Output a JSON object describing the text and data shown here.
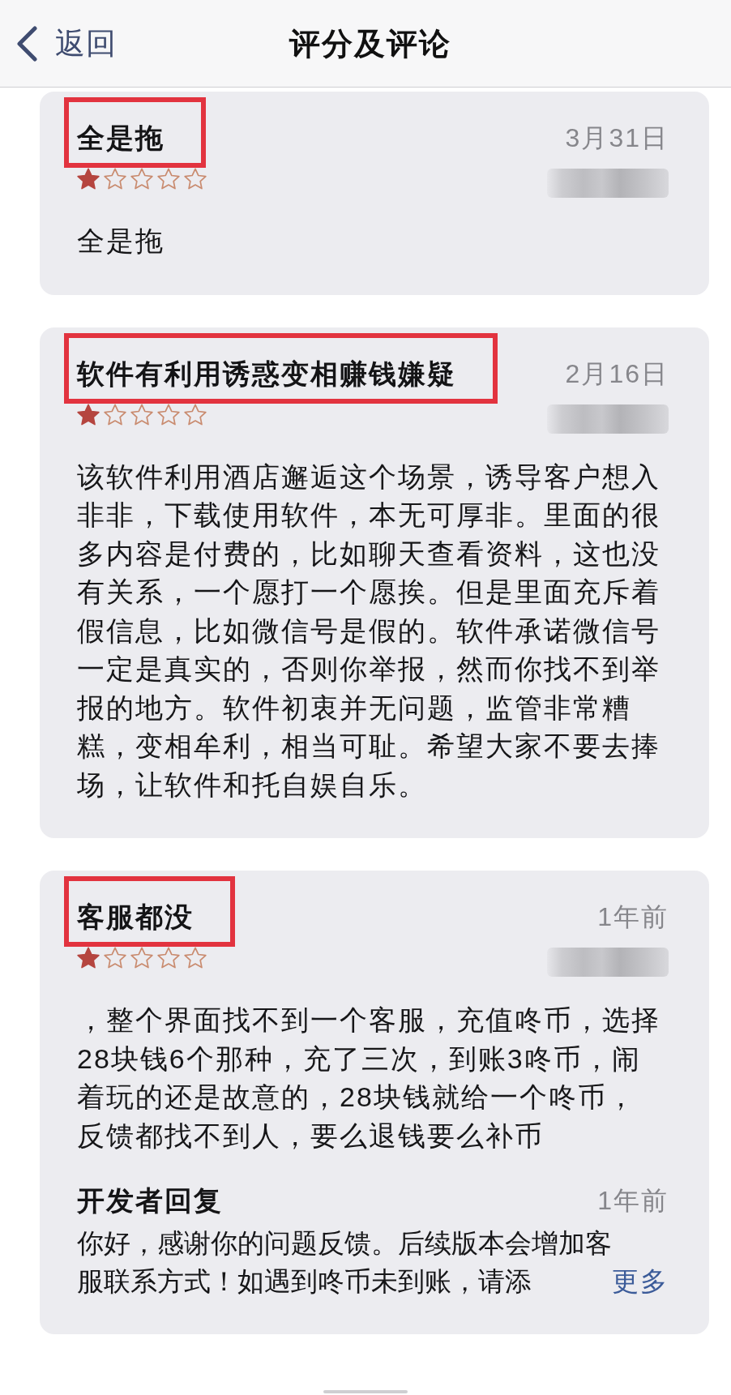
{
  "nav_bar": {
    "back_label": "返回",
    "title": "评分及评论"
  },
  "reviews": [
    {
      "title": "全是拖",
      "highlighted": true,
      "date": "3月31日",
      "stars": 1,
      "body": "全是拖"
    },
    {
      "title": "软件有利用诱惑变相赚钱嫌疑",
      "highlighted": true,
      "date": "2月16日",
      "stars": 1,
      "body": "该软件利用酒店邂逅这个场景，诱导客户想入非非，下载使用软件，本无可厚非。里面的很多内容是付费的，比如聊天查看资料，这也没有关系，一个愿打一个愿挨。但是里面充斥着假信息，比如微信号是假的。软件承诺微信号一定是真实的，否则你举报，然而你找不到举报的地方。软件初衷并无问题，监管非常糟糕，变相牟利，相当可耻。希望大家不要去捧场，让软件和托自娱自乐。"
    },
    {
      "title": "客服都没",
      "highlighted": true,
      "date": "1年前",
      "stars": 1,
      "body": "，整个界面找不到一个客服，充值咚币，选择28块钱6个那种，充了三次，到账3咚币，闹着玩的还是故意的，28块钱就给一个咚币，反馈都找不到人，要么退钱要么补币",
      "developer_response": {
        "heading": "开发者回复",
        "date": "1年前",
        "body": "你好，感谢你的问题反馈。后续版本会增加客服联系方式！如遇到咚币未到账，请添",
        "more_link": "更多"
      }
    }
  ]
}
